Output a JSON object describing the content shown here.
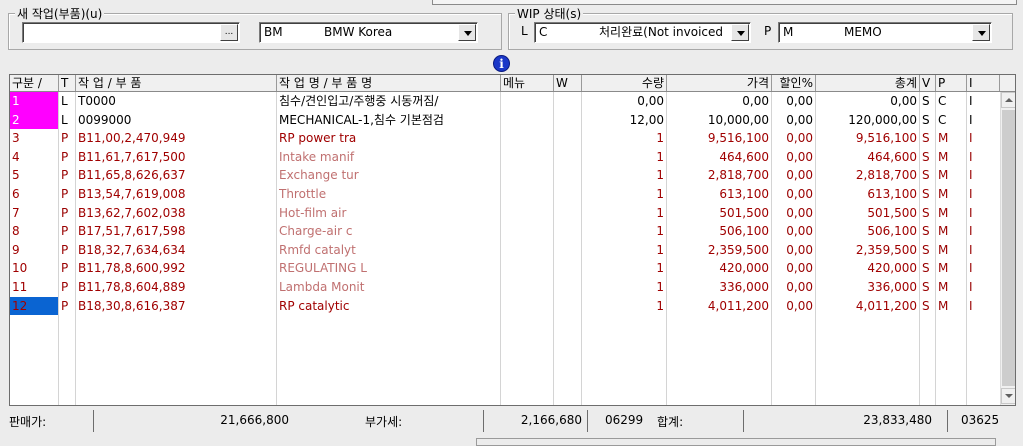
{
  "top_group": {
    "legend": "새 작업(부품)(u)",
    "browse_label": "...",
    "brand_code": "BM",
    "brand_name": "BMW Korea"
  },
  "wip_group": {
    "legend": "WIP 상태(s)",
    "status_prefix": "L",
    "status_code": "C",
    "status_text": "처리완료(Not invoiced",
    "memo_prefix": "P",
    "memo_code": "M",
    "memo_text": "MEMO"
  },
  "info_icon": "info-icon",
  "columns": [
    "구분 /",
    "T",
    "작 업 / 부 품",
    "작 업 명 / 부 품 명",
    "메뉴",
    "W",
    "수량",
    "가격",
    "할인%",
    "총계",
    "V",
    "P",
    "I"
  ],
  "rows": [
    {
      "idx": "1",
      "t": "L",
      "code": "T0000",
      "name": "침수/견인입고/주행중 시동꺼짐/",
      "qty": "0,00",
      "price": "0,00",
      "disc": "0,00",
      "total": "0,00",
      "v": "S",
      "p": "C",
      "i": "I",
      "kind": "L",
      "mark": "mag"
    },
    {
      "idx": "2",
      "t": "L",
      "code": "0099000",
      "name": "MECHANICAL-1,침수 기본점검",
      "qty": "12,00",
      "price": "10,000,00",
      "disc": "0,00",
      "total": "120,000,00",
      "v": "S",
      "p": "C",
      "i": "I",
      "kind": "L",
      "mark": "mag"
    },
    {
      "idx": "3",
      "t": "P",
      "code": "B11,00,2,470,949",
      "name": "RP power tra",
      "qty": "1",
      "price": "9,516,100",
      "disc": "0,00",
      "total": "9,516,100",
      "v": "S",
      "p": "M",
      "i": "I",
      "kind": "P",
      "mark": "none"
    },
    {
      "idx": "4",
      "t": "P",
      "code": "B11,61,7,617,500",
      "name": "Intake manif",
      "qty": "1",
      "price": "464,600",
      "disc": "0,00",
      "total": "464,600",
      "v": "S",
      "p": "M",
      "i": "I",
      "kind": "P",
      "mark": "none"
    },
    {
      "idx": "5",
      "t": "P",
      "code": "B11,65,8,626,637",
      "name": "Exchange tur",
      "qty": "1",
      "price": "2,818,700",
      "disc": "0,00",
      "total": "2,818,700",
      "v": "S",
      "p": "M",
      "i": "I",
      "kind": "P",
      "mark": "none"
    },
    {
      "idx": "6",
      "t": "P",
      "code": "B13,54,7,619,008",
      "name": "Throttle",
      "qty": "1",
      "price": "613,100",
      "disc": "0,00",
      "total": "613,100",
      "v": "S",
      "p": "M",
      "i": "I",
      "kind": "P",
      "mark": "none"
    },
    {
      "idx": "7",
      "t": "P",
      "code": "B13,62,7,602,038",
      "name": "Hot-film air",
      "qty": "1",
      "price": "501,500",
      "disc": "0,00",
      "total": "501,500",
      "v": "S",
      "p": "M",
      "i": "I",
      "kind": "P",
      "mark": "none"
    },
    {
      "idx": "8",
      "t": "P",
      "code": "B17,51,7,617,598",
      "name": "Charge-air c",
      "qty": "1",
      "price": "506,100",
      "disc": "0,00",
      "total": "506,100",
      "v": "S",
      "p": "M",
      "i": "I",
      "kind": "P",
      "mark": "none"
    },
    {
      "idx": "9",
      "t": "P",
      "code": "B18,32,7,634,634",
      "name": "Rmfd catalyt",
      "qty": "1",
      "price": "2,359,500",
      "disc": "0,00",
      "total": "2,359,500",
      "v": "S",
      "p": "M",
      "i": "I",
      "kind": "P",
      "mark": "none"
    },
    {
      "idx": "10",
      "t": "P",
      "code": "B11,78,8,600,992",
      "name": "REGULATING L",
      "qty": "1",
      "price": "420,000",
      "disc": "0,00",
      "total": "420,000",
      "v": "S",
      "p": "M",
      "i": "I",
      "kind": "P",
      "mark": "none"
    },
    {
      "idx": "11",
      "t": "P",
      "code": "B11,78,8,604,889",
      "name": "Lambda Monit",
      "qty": "1",
      "price": "336,000",
      "disc": "0,00",
      "total": "336,000",
      "v": "S",
      "p": "M",
      "i": "I",
      "kind": "P",
      "mark": "none"
    },
    {
      "idx": "12",
      "t": "P",
      "code": "B18,30,8,616,387",
      "name": "RP catalytic",
      "qty": "1",
      "price": "4,011,200",
      "disc": "0,00",
      "total": "4,011,200",
      "v": "S",
      "p": "M",
      "i": "I",
      "kind": "P",
      "mark": "blue"
    }
  ],
  "footer": {
    "sales_label": "판매가:",
    "sales_value": "21,666,800",
    "vat_label": "부가세:",
    "vat_value": "2,166,680",
    "code1": "06299",
    "total_label": "합계:",
    "total_value": "23,833,480",
    "code2": "03625"
  },
  "colors": {
    "index_highlight": "#ff00ff",
    "selected_index": "#0a64d2",
    "part_row_text": "#a00000"
  }
}
